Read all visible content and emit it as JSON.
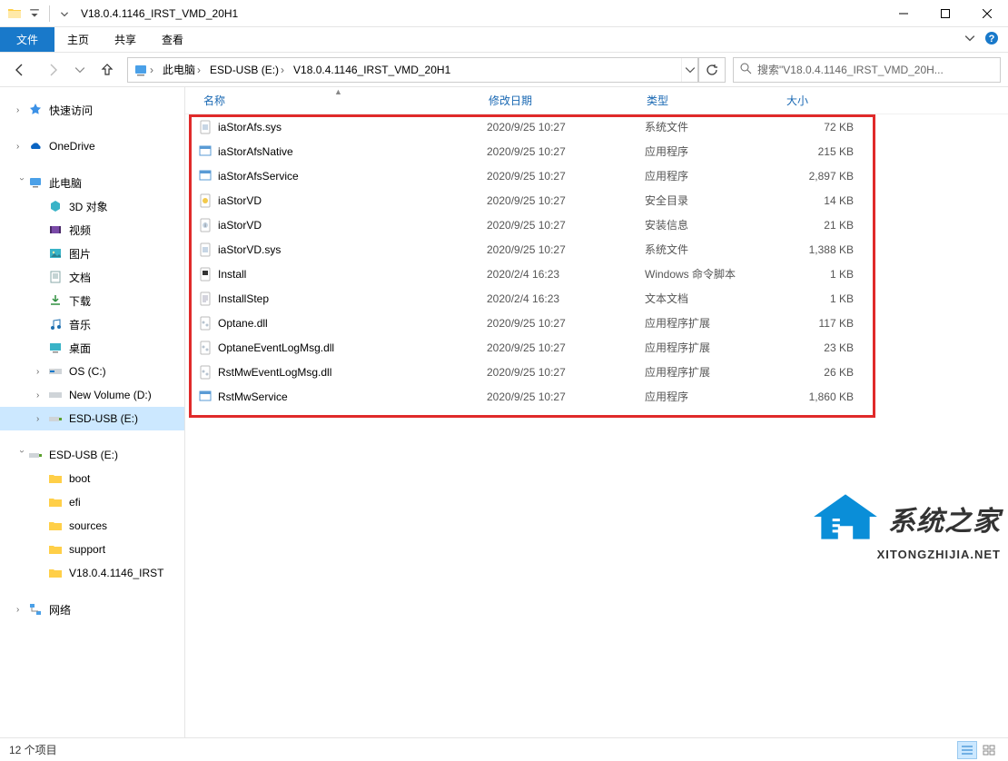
{
  "window": {
    "title": "V18.0.4.1146_IRST_VMD_20H1"
  },
  "ribbon": {
    "file": "文件",
    "tabs": [
      "主页",
      "共享",
      "查看"
    ]
  },
  "breadcrumbs": {
    "items": [
      "此电脑",
      "ESD-USB (E:)",
      "V18.0.4.1146_IRST_VMD_20H1"
    ]
  },
  "search": {
    "placeholder": "搜索\"V18.0.4.1146_IRST_VMD_20H..."
  },
  "sidebar": {
    "quick_access": "快速访问",
    "onedrive": "OneDrive",
    "this_pc": "此电脑",
    "pc_children": [
      "3D 对象",
      "视频",
      "图片",
      "文档",
      "下载",
      "音乐",
      "桌面",
      "OS (C:)",
      "New Volume (D:)",
      "ESD-USB (E:)"
    ],
    "esd_usb": "ESD-USB (E:)",
    "esd_children": [
      "boot",
      "efi",
      "sources",
      "support",
      "V18.0.4.1146_IRST"
    ],
    "network": "网络"
  },
  "columns": {
    "name": "名称",
    "date": "修改日期",
    "type": "类型",
    "size": "大小"
  },
  "files": [
    {
      "icon": "sys",
      "name": "iaStorAfs.sys",
      "date": "2020/9/25 10:27",
      "type": "系统文件",
      "size": "72 KB"
    },
    {
      "icon": "exe",
      "name": "iaStorAfsNative",
      "date": "2020/9/25 10:27",
      "type": "应用程序",
      "size": "215 KB"
    },
    {
      "icon": "exe",
      "name": "iaStorAfsService",
      "date": "2020/9/25 10:27",
      "type": "应用程序",
      "size": "2,897 KB"
    },
    {
      "icon": "cat",
      "name": "iaStorVD",
      "date": "2020/9/25 10:27",
      "type": "安全目录",
      "size": "14 KB"
    },
    {
      "icon": "inf",
      "name": "iaStorVD",
      "date": "2020/9/25 10:27",
      "type": "安装信息",
      "size": "21 KB"
    },
    {
      "icon": "sys",
      "name": "iaStorVD.sys",
      "date": "2020/9/25 10:27",
      "type": "系统文件",
      "size": "1,388 KB"
    },
    {
      "icon": "cmd",
      "name": "Install",
      "date": "2020/2/4 16:23",
      "type": "Windows 命令脚本",
      "size": "1 KB"
    },
    {
      "icon": "txt",
      "name": "InstallStep",
      "date": "2020/2/4 16:23",
      "type": "文本文档",
      "size": "1 KB"
    },
    {
      "icon": "dll",
      "name": "Optane.dll",
      "date": "2020/9/25 10:27",
      "type": "应用程序扩展",
      "size": "117 KB"
    },
    {
      "icon": "dll",
      "name": "OptaneEventLogMsg.dll",
      "date": "2020/9/25 10:27",
      "type": "应用程序扩展",
      "size": "23 KB"
    },
    {
      "icon": "dll",
      "name": "RstMwEventLogMsg.dll",
      "date": "2020/9/25 10:27",
      "type": "应用程序扩展",
      "size": "26 KB"
    },
    {
      "icon": "exe",
      "name": "RstMwService",
      "date": "2020/9/25 10:27",
      "type": "应用程序",
      "size": "1,860 KB"
    }
  ],
  "status": {
    "count": "12 个项目"
  },
  "watermark": {
    "text": "系统之家",
    "url": "XITONGZHIJIA.NET"
  }
}
